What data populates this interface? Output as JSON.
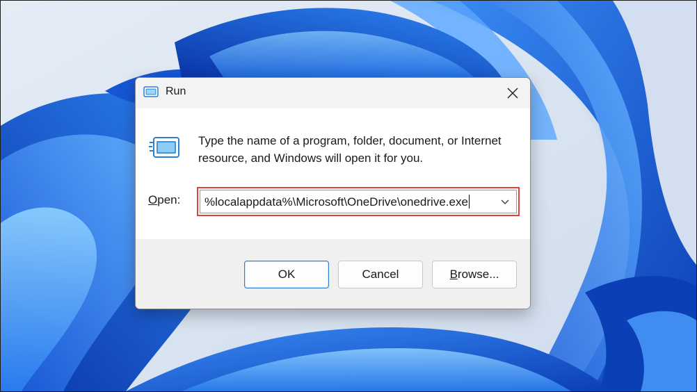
{
  "dialog": {
    "title": "Run",
    "description": "Type the name of a program, folder, document, or Internet resource, and Windows will open it for you.",
    "open_label_accel": "O",
    "open_label_rest": "pen:",
    "open_value": "%localappdata%\\Microsoft\\OneDrive\\onedrive.exe",
    "buttons": {
      "ok": "OK",
      "cancel": "Cancel",
      "browse_accel": "B",
      "browse_rest": "rowse..."
    }
  },
  "icons": {
    "title": "run-icon",
    "content": "run-icon",
    "close": "close-icon",
    "dropdown": "chevron-down-icon"
  },
  "colors": {
    "highlight": "#e0413a",
    "default_button_border": "#2e7bd6",
    "wallpaper_blue": "#1e63e6"
  }
}
